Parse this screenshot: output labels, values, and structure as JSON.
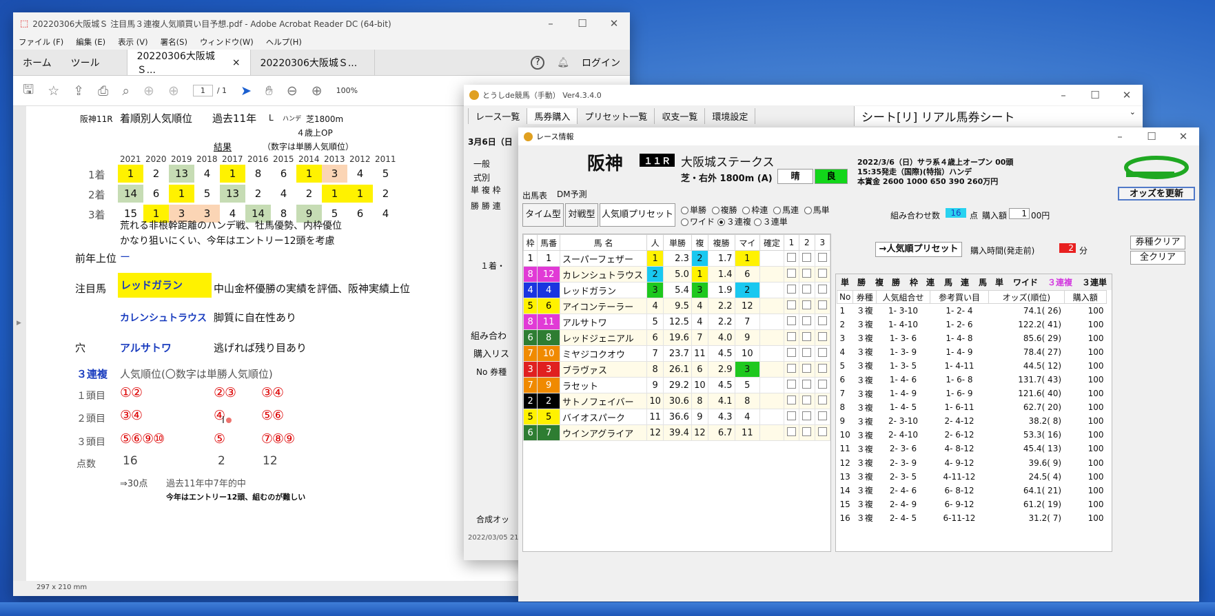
{
  "acrobat": {
    "title": "20220306大阪城Ｓ 注目馬３連複人気順買い目予想.pdf - Adobe Acrobat Reader DC (64-bit)",
    "menu": [
      "ファイル (F)",
      "編集 (E)",
      "表示 (V)",
      "署名(S)",
      "ウィンドウ(W)",
      "ヘルプ(H)"
    ],
    "tab_home": "ホーム",
    "tab_tools": "ツール",
    "tab_doc1": "20220306大阪城Ｓ...",
    "tab_doc2": "20220306大阪城Ｓ...",
    "login": "ログイン",
    "page_current": "1",
    "page_total": "/ 1",
    "zoom": "100%",
    "page_size": "297 x 210 mm"
  },
  "doc": {
    "race": "阪神11R",
    "heading": "着順別人気順位",
    "years_label": "過去11年",
    "l": "L",
    "handicap": "ハンデ",
    "course": "芝1800m",
    "class": "４歳上OP",
    "result": "結果",
    "note": "（数字は単勝人気順位）",
    "years": [
      "2021",
      "2020",
      "2019",
      "2018",
      "2017",
      "2016",
      "2015",
      "2014",
      "2013",
      "2012",
      "2011"
    ],
    "rows": [
      {
        "label": "1着",
        "vals": [
          "1",
          "2",
          "13",
          "4",
          "1",
          "8",
          "6",
          "1",
          "3",
          "4",
          "5"
        ],
        "hl": [
          "y",
          "",
          "g",
          "",
          "y",
          "",
          "",
          "y",
          "o",
          "",
          ""
        ]
      },
      {
        "label": "2着",
        "vals": [
          "14",
          "6",
          "1",
          "5",
          "13",
          "2",
          "4",
          "2",
          "1",
          "1",
          "2"
        ],
        "hl": [
          "g",
          "",
          "y",
          "",
          "g",
          "",
          "",
          "",
          "y",
          "y",
          ""
        ]
      },
      {
        "label": "3着",
        "vals": [
          "15",
          "1",
          "3",
          "3",
          "4",
          "14",
          "8",
          "9",
          "5",
          "6",
          "4"
        ],
        "hl": [
          "",
          "y",
          "o",
          "o",
          "",
          "g",
          "",
          "g",
          "",
          "",
          ""
        ]
      }
    ],
    "comment1": "荒れる非根幹距離のハンデ戦、牡馬優勢、内枠優位",
    "comment2": "かなり狙いにくい、今年はエントリー12頭を考慮",
    "prev_label": "前年上位",
    "prev_val": "ー",
    "focus_label": "注目馬",
    "focus_horse": "レッドガラン",
    "focus_note": "中山金杯優勝の実績を評価、阪神実績上位",
    "horse2": "カレンシュトラウス",
    "horse2_note": "脚質に自在性あり",
    "ana_label": "穴",
    "ana_horse": "アルサトワ",
    "ana_note": "逃げれば残り目あり",
    "sanrenpuku": "３連複",
    "pop_note": "人気順位(〇数字は単勝人気順位)",
    "r1": "１頭目",
    "r2": "２頭目",
    "r3": "３頭目",
    "pts": "点数",
    "c1": [
      "①②",
      "③④",
      "⑤⑥⑨⑩",
      "16"
    ],
    "c2": [
      "②③",
      "④",
      "⑤",
      "2"
    ],
    "c3": [
      "③④",
      "⑤⑥",
      "⑦⑧⑨",
      "12"
    ],
    "tail1": "⇒30点",
    "tail2": "過去11年中7年的中",
    "tail3": "今年はエントリー12頭、組むのが難しい"
  },
  "toushi": {
    "title": "とうしde競馬（手動） Ver4.3.4.0",
    "menu": [
      "レース一覧",
      "馬券購入",
      "プリセット一覧",
      "収支一覧",
      "環境設定"
    ],
    "sheet": "シート[リ] リアル馬券シート",
    "date": "3月6日（日",
    "side": [
      "一般",
      "式別",
      "単 複 枠",
      "勝 勝 連",
      "１着・",
      "組み合わ",
      "購入リス",
      "No 券種",
      "合成オッ",
      "2022/03/05 21"
    ]
  },
  "race": {
    "title": "レース情報",
    "track": "阪神",
    "rno": "１１Ｒ",
    "name": "大阪城ステークス",
    "course": "芝・右外 1800m (A)",
    "weather": "晴",
    "ground": "良",
    "info1": "2022/3/6（日）サラ系４歳上オープン 00頭",
    "info2": "15:35発走（国際)(特指）ハンデ",
    "info3": "本賞金 2600 1000 650 390 260万円",
    "update": "オッズを更新",
    "tab1": "出馬表",
    "tab2": "DM予測",
    "btn_time": "タイム型",
    "btn_taisen": "対戦型",
    "btn_ninki": "人気順プリセット",
    "bettypes": [
      "単勝",
      "複勝",
      "枠連",
      "馬連",
      "馬単",
      "ワイド",
      "３連複",
      "３連単"
    ],
    "combo_label": "組み合わせ数",
    "combo": "16",
    "combo_unit": "点",
    "buy_label": "購入額",
    "buy": "1",
    "buy_unit": "00円",
    "preset_btn": "→人気順プリセット",
    "time_label": "購入時間(発走前)",
    "time": "2",
    "time_unit": "分",
    "clear1": "券種クリア",
    "clear2": "全クリア",
    "head": [
      "枠",
      "馬番",
      "馬 名",
      "人",
      "単勝",
      "複",
      "複勝",
      "マイ",
      "確定",
      "1",
      "2",
      "3"
    ],
    "horses": [
      {
        "w": "1",
        "n": "1",
        "name": "スーパーフェザー",
        "p": "1",
        "win": "2.3",
        "f": "2",
        "fuku": "1.7",
        "my": "1",
        "wc": "#ffffff",
        "wt": "#000",
        "pc": "#fff200",
        "fc": "#19c8f0",
        "mc": "#fff200"
      },
      {
        "w": "8",
        "n": "12",
        "name": "カレンシュトラウス",
        "p": "2",
        "win": "5.0",
        "f": "1",
        "fuku": "1.4",
        "my": "6",
        "wc": "#e13ad6",
        "wt": "#fff",
        "pc": "#19c8f0",
        "fc": "#fff200",
        "mc": ""
      },
      {
        "w": "4",
        "n": "4",
        "name": "レッドガラン",
        "p": "3",
        "win": "5.4",
        "f": "3",
        "fuku": "1.9",
        "my": "2",
        "wc": "#1a35e0",
        "wt": "#fff",
        "pc": "#1ec81e",
        "fc": "#1ec81e",
        "mc": "#19c8f0"
      },
      {
        "w": "5",
        "n": "6",
        "name": "アイコンテーラー",
        "p": "4",
        "win": "9.5",
        "f": "4",
        "fuku": "2.2",
        "my": "12",
        "wc": "#fff200",
        "wt": "#000",
        "pc": "",
        "fc": "",
        "mc": ""
      },
      {
        "w": "8",
        "n": "11",
        "name": "アルサトワ",
        "p": "5",
        "win": "12.5",
        "f": "4",
        "fuku": "2.2",
        "my": "7",
        "wc": "#e13ad6",
        "wt": "#fff",
        "pc": "",
        "fc": "",
        "mc": ""
      },
      {
        "w": "6",
        "n": "8",
        "name": "レッドジェニアル",
        "p": "6",
        "win": "19.6",
        "f": "7",
        "fuku": "4.0",
        "my": "9",
        "wc": "#2e7d32",
        "wt": "#fff",
        "pc": "",
        "fc": "",
        "mc": ""
      },
      {
        "w": "7",
        "n": "10",
        "name": "ミヤジコクオウ",
        "p": "7",
        "win": "23.7",
        "f": "11",
        "fuku": "4.5",
        "my": "10",
        "wc": "#f08a00",
        "wt": "#fff",
        "pc": "",
        "fc": "",
        "mc": ""
      },
      {
        "w": "3",
        "n": "3",
        "name": "ブラヴァス",
        "p": "8",
        "win": "26.1",
        "f": "6",
        "fuku": "2.9",
        "my": "3",
        "wc": "#e02020",
        "wt": "#fff",
        "pc": "",
        "fc": "",
        "mc": "#1ec81e"
      },
      {
        "w": "7",
        "n": "9",
        "name": "ラセット",
        "p": "9",
        "win": "29.2",
        "f": "10",
        "fuku": "4.5",
        "my": "5",
        "wc": "#f08a00",
        "wt": "#fff",
        "pc": "",
        "fc": "",
        "mc": ""
      },
      {
        "w": "2",
        "n": "2",
        "name": "サトノフェイバー",
        "p": "10",
        "win": "30.6",
        "f": "8",
        "fuku": "4.1",
        "my": "8",
        "wc": "#000000",
        "wt": "#fff",
        "pc": "",
        "fc": "",
        "mc": ""
      },
      {
        "w": "5",
        "n": "5",
        "name": "バイオスパーク",
        "p": "11",
        "win": "36.6",
        "f": "9",
        "fuku": "4.3",
        "my": "4",
        "wc": "#fff200",
        "wt": "#000",
        "pc": "",
        "fc": "",
        "mc": ""
      },
      {
        "w": "6",
        "n": "7",
        "name": "ウインアグライア",
        "p": "12",
        "win": "39.4",
        "f": "12",
        "fuku": "6.7",
        "my": "11",
        "wc": "#2e7d32",
        "wt": "#fff",
        "pc": "",
        "fc": "",
        "mc": ""
      }
    ],
    "typebar": [
      "単　勝",
      "複　勝",
      "枠　連",
      "馬　連",
      "馬　単",
      "ワイド",
      "３連複",
      "３連単"
    ],
    "ohead": [
      "No",
      "券種",
      "人気組合せ",
      "参考買い目",
      "オッズ(順位)",
      "購入額"
    ],
    "orders": [
      [
        "1",
        "３複",
        "1- 3-10",
        "1- 2- 4",
        "74.1(  26)",
        "100"
      ],
      [
        "2",
        "３複",
        "1- 4-10",
        "1- 2- 6",
        "122.2(  41)",
        "100"
      ],
      [
        "3",
        "３複",
        "1- 3- 6",
        "1- 4- 8",
        "85.6(  29)",
        "100"
      ],
      [
        "4",
        "３複",
        "1- 3- 9",
        "1- 4- 9",
        "78.4(  27)",
        "100"
      ],
      [
        "5",
        "３複",
        "1- 3- 5",
        "1- 4-11",
        "44.5(  12)",
        "100"
      ],
      [
        "6",
        "３複",
        "1- 4- 6",
        "1- 6- 8",
        "131.7(  43)",
        "100"
      ],
      [
        "7",
        "３複",
        "1- 4- 9",
        "1- 6- 9",
        "121.6(  40)",
        "100"
      ],
      [
        "8",
        "３複",
        "1- 4- 5",
        "1- 6-11",
        "62.7(  20)",
        "100"
      ],
      [
        "9",
        "３複",
        "2- 3-10",
        "2- 4-12",
        "38.2(   8)",
        "100"
      ],
      [
        "10",
        "３複",
        "2- 4-10",
        "2- 6-12",
        "53.3(  16)",
        "100"
      ],
      [
        "11",
        "３複",
        "2- 3- 6",
        "4- 8-12",
        "45.4(  13)",
        "100"
      ],
      [
        "12",
        "３複",
        "2- 3- 9",
        "4- 9-12",
        "39.6(   9)",
        "100"
      ],
      [
        "13",
        "３複",
        "2- 3- 5",
        "4-11-12",
        "24.5(   4)",
        "100"
      ],
      [
        "14",
        "３複",
        "2- 4- 6",
        "6- 8-12",
        "64.1(  21)",
        "100"
      ],
      [
        "15",
        "３複",
        "2- 4- 9",
        "6- 9-12",
        "61.2(  19)",
        "100"
      ],
      [
        "16",
        "３複",
        "2- 4- 5",
        "6-11-12",
        "31.2(   7)",
        "100"
      ]
    ]
  }
}
